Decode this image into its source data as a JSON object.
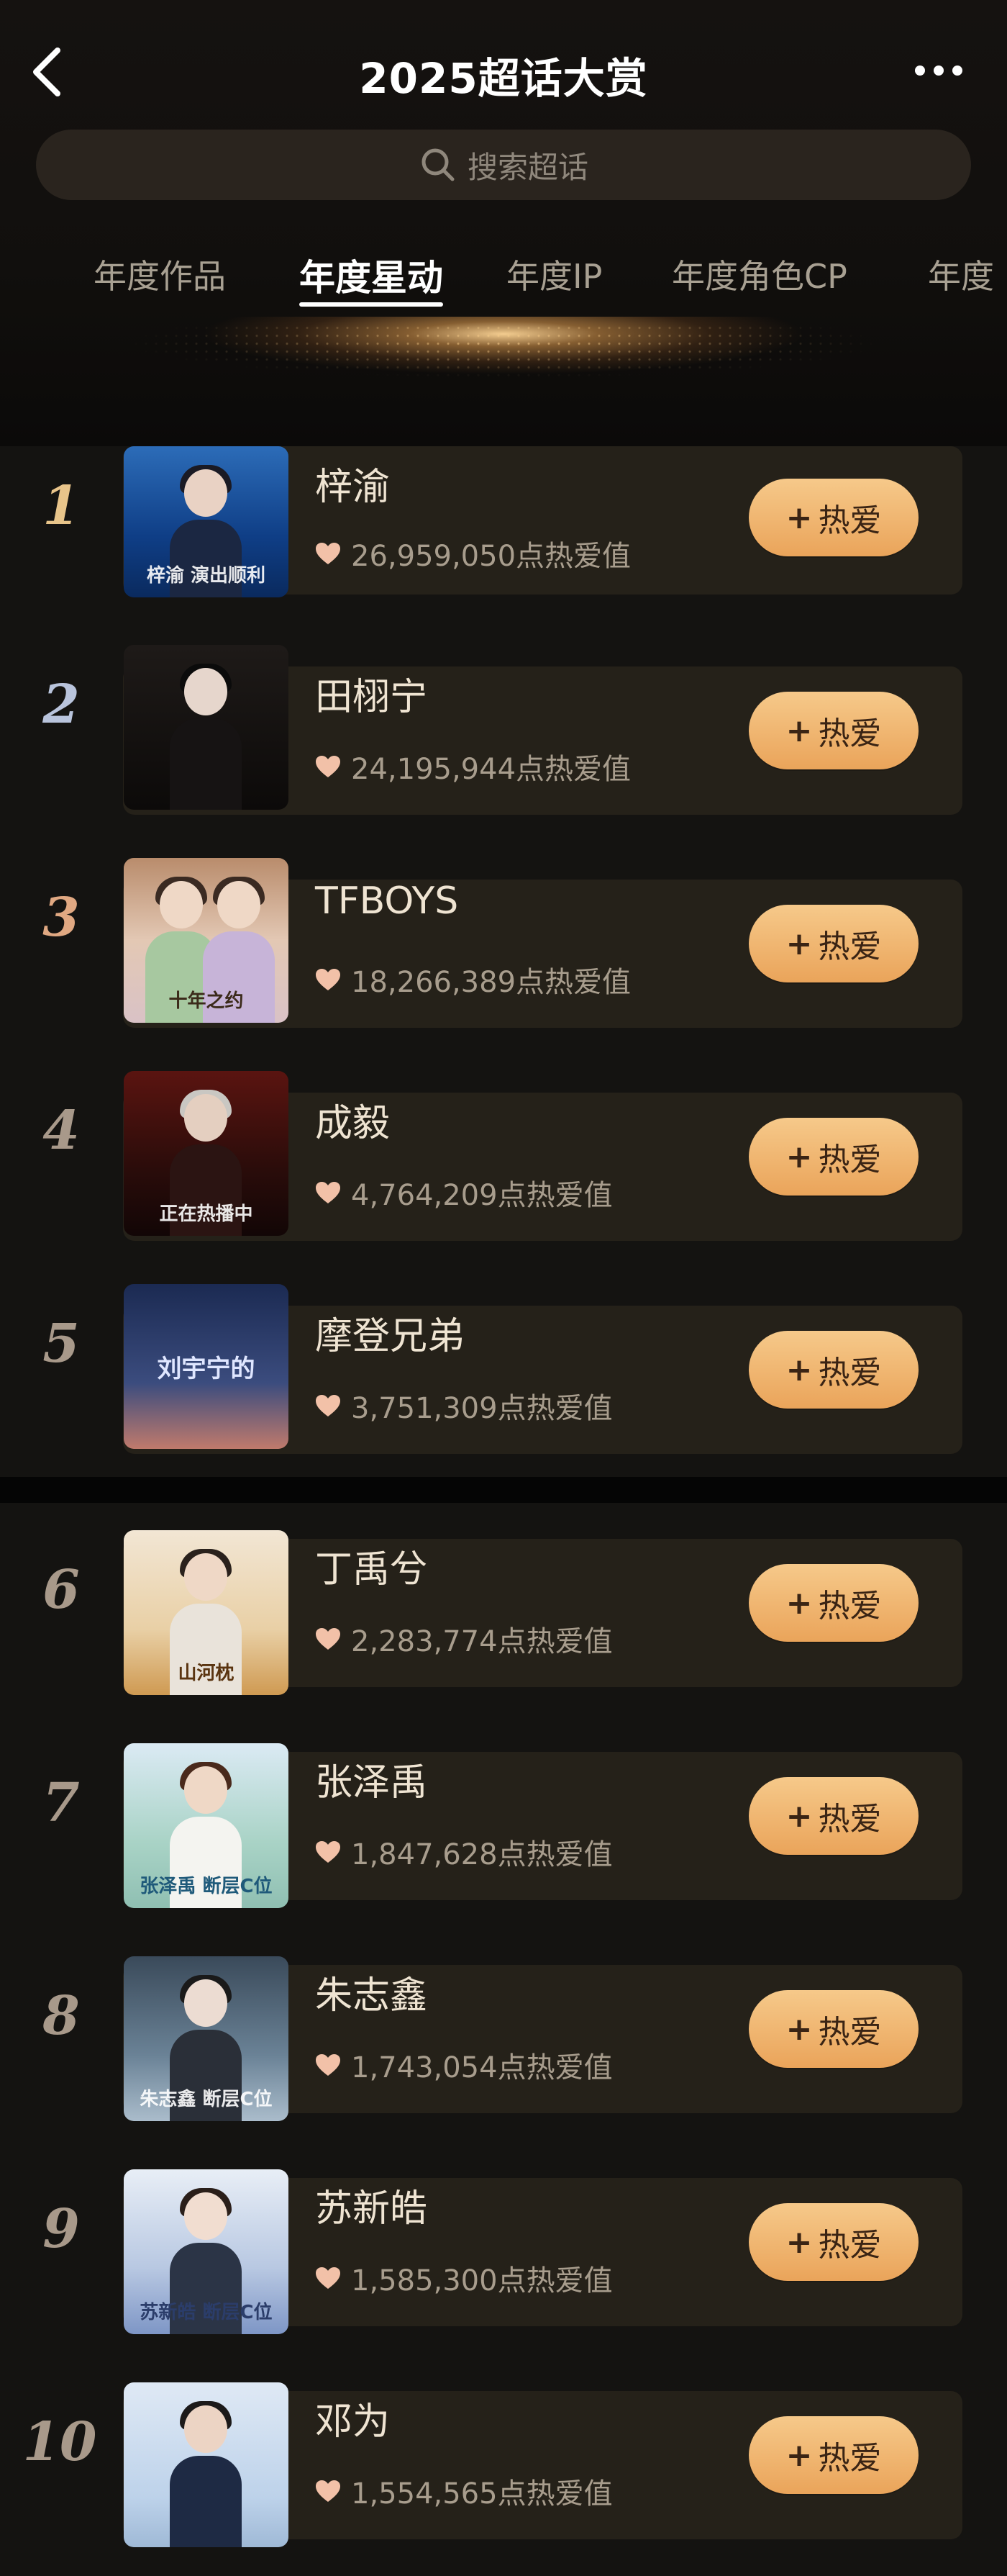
{
  "header": {
    "title": "2025超话大赏",
    "search_placeholder": "搜索超话",
    "tabs": [
      {
        "label": "年度作品"
      },
      {
        "label": "年度星动"
      },
      {
        "label": "年度IP"
      },
      {
        "label": "年度角色CP"
      },
      {
        "label": "年度"
      }
    ],
    "active_tab": "年度星动"
  },
  "button_label": "热爱",
  "button_plus": "+",
  "colors": {
    "background": "#0e0e0e",
    "card": "#252119",
    "button_gradient_top": "#f6c98a",
    "button_gradient_bottom": "#eaa45a",
    "heart": "#f2c1a8"
  },
  "ranking": [
    {
      "rank": "1",
      "name": "梓渝",
      "score": "26,959,050点热爱值",
      "thumb_text": "梓渝 演出顺利"
    },
    {
      "rank": "2",
      "name": "田栩宁",
      "score": "24,195,944点热爱值",
      "thumb_text": ""
    },
    {
      "rank": "3",
      "name": "TFBOYS",
      "score": "18,266,389点热爱值",
      "thumb_text": "十年之约"
    },
    {
      "rank": "4",
      "name": "成毅",
      "score": "4,764,209点热爱值",
      "thumb_text": "正在热播中"
    },
    {
      "rank": "5",
      "name": "摩登兄弟",
      "score": "3,751,309点热爱值",
      "thumb_text": "刘宇宁的"
    },
    {
      "rank": "6",
      "name": "丁禹兮",
      "score": "2,283,774点热爱值",
      "thumb_text": "山河枕"
    },
    {
      "rank": "7",
      "name": "张泽禹",
      "score": "1,847,628点热爱值",
      "thumb_text": "张泽禹 断层C位"
    },
    {
      "rank": "8",
      "name": "朱志鑫",
      "score": "1,743,054点热爱值",
      "thumb_text": "朱志鑫 断层C位"
    },
    {
      "rank": "9",
      "name": "苏新皓",
      "score": "1,585,300点热爱值",
      "thumb_text": "苏新皓 断层C位"
    },
    {
      "rank": "10",
      "name": "邓为",
      "score": "1,554,565点热爱值",
      "thumb_text": ""
    }
  ]
}
